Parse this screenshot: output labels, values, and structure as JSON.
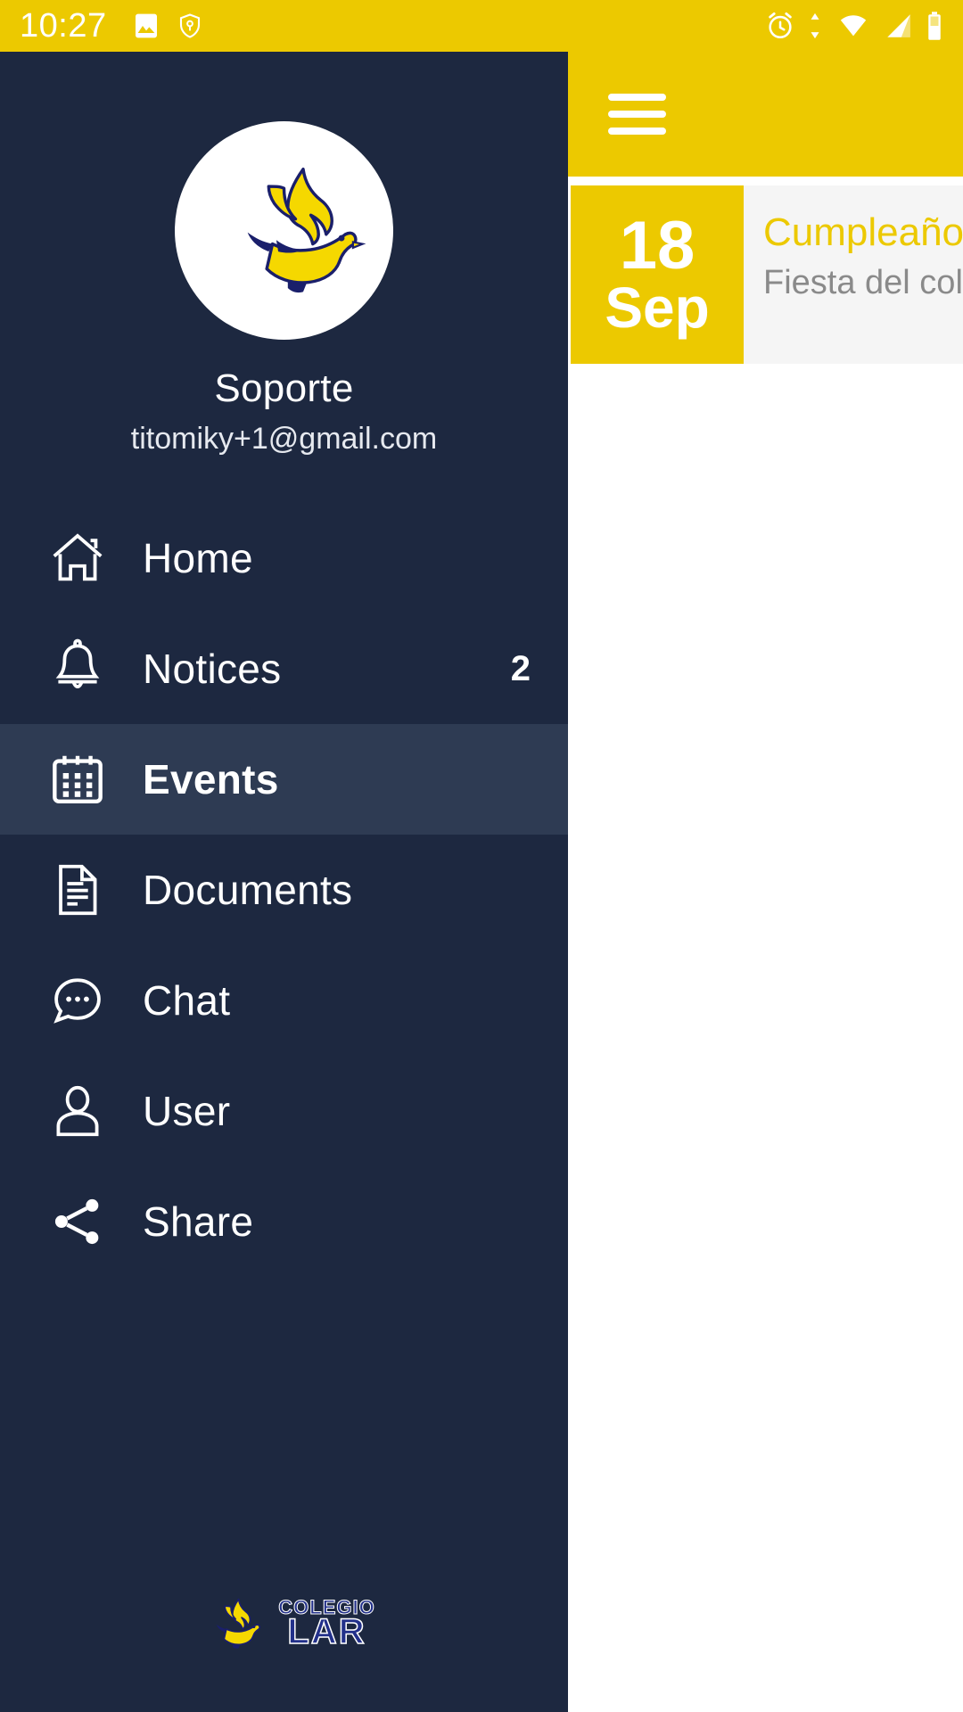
{
  "status_bar": {
    "time": "10:27",
    "left_icons": [
      "image-icon",
      "shield-location-icon"
    ],
    "right_icons": [
      "alarm-icon",
      "data-transfer-icon",
      "wifi-icon",
      "signal-icon",
      "battery-icon"
    ],
    "background_color": "#ecc900",
    "foreground_color": "#ffffff"
  },
  "app_bar": {
    "menu_icon": "hamburger-icon",
    "background_color": "#ecc900"
  },
  "event_card": {
    "day": "18",
    "month": "Sep",
    "title": "Cumpleaños",
    "subtitle": "Fiesta del colegio",
    "date_bg_color": "#ecc900",
    "body_bg_color": "#f5f5f5",
    "title_color": "#ecc900"
  },
  "drawer": {
    "background_color": "#1d2840",
    "active_background_color": "#2e3b53",
    "profile": {
      "avatar_icon": "dove-logo-icon",
      "name": "Soporte",
      "email": "titomiky+1@gmail.com"
    },
    "items": [
      {
        "label": "Home",
        "icon": "home-icon",
        "badge": "",
        "active": false
      },
      {
        "label": "Notices",
        "icon": "bell-icon",
        "badge": "2",
        "active": false
      },
      {
        "label": "Events",
        "icon": "calendar-icon",
        "badge": "",
        "active": true
      },
      {
        "label": "Documents",
        "icon": "document-icon",
        "badge": "",
        "active": false
      },
      {
        "label": "Chat",
        "icon": "chat-icon",
        "badge": "",
        "active": false
      },
      {
        "label": "User",
        "icon": "user-icon",
        "badge": "",
        "active": false
      },
      {
        "label": "Share",
        "icon": "share-icon",
        "badge": "",
        "active": false
      }
    ],
    "footer": {
      "logo_icon": "dove-logo-icon",
      "line1": "COLEGIO",
      "line2": "LAR",
      "brand_color": "#22308a",
      "accent_color": "#f5d800"
    }
  }
}
